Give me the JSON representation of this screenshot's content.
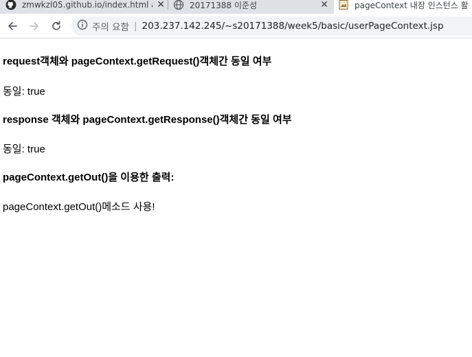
{
  "tabs": [
    {
      "label": "zmwkzl05.github.io/index.html a",
      "icon": "github-icon",
      "close": "✕"
    },
    {
      "label": "20171388 이준성",
      "icon": "globe-icon",
      "close": "✕"
    },
    {
      "label": "pageContext 내장 인스턴스 활",
      "icon": "page-icon",
      "active": true
    }
  ],
  "toolbar": {
    "security_label": "주의 요함",
    "separator": "|",
    "url": "203.237.142.245/~s20171388/week5/basic/userPageContext.jsp"
  },
  "page": {
    "heading1": "request객체와 pageContext.getRequest()객체간 동일 여부",
    "result1": "동일: true",
    "heading2": "response 객체와 pageContext.getResponse()객체간 동일 여부",
    "result2": "동일: true",
    "heading3": "pageContext.getOut()을 이용한 출력:",
    "output": "pageContext.getOut()메소드 사용!"
  }
}
